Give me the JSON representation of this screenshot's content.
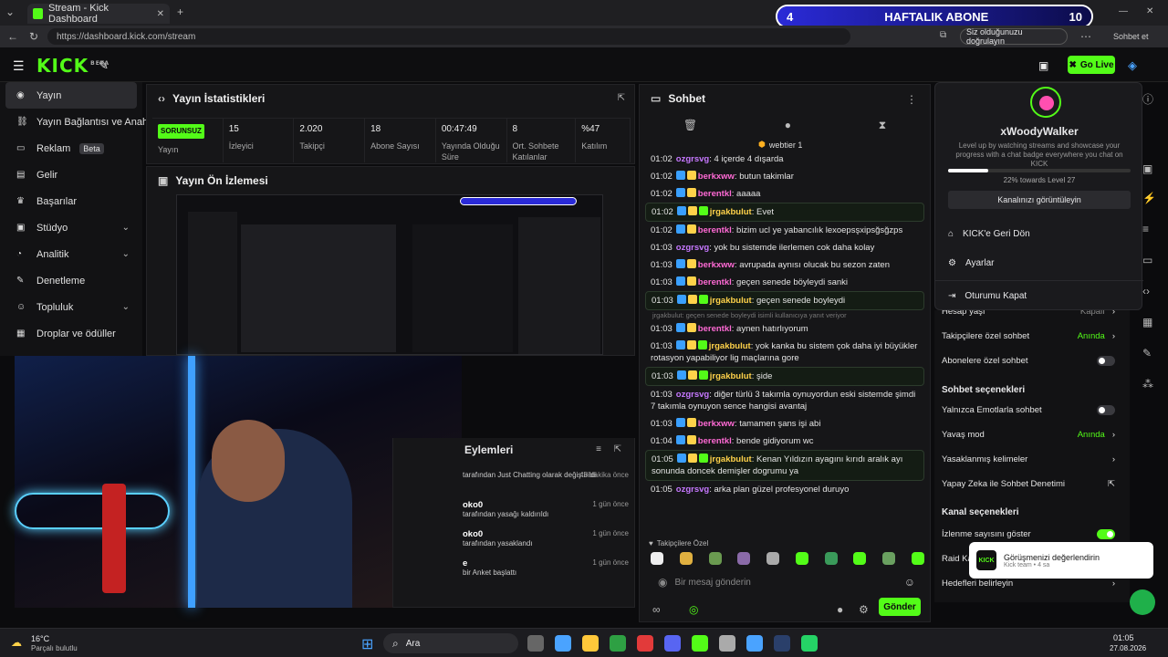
{
  "browser": {
    "tab_title": "Stream - Kick Dashboard",
    "url": "https://dashboard.kick.com/stream",
    "verify_text": "Siz olduğunuzu doğrulayın",
    "sign_in": "Sohbet et"
  },
  "goal_overlay": {
    "left": "4",
    "title": "HAFTALIK ABONE",
    "right": "10"
  },
  "header": {
    "logo": "KICK",
    "beta": "BETA",
    "go_live": "Go Live"
  },
  "sidebar": {
    "items": [
      {
        "label": "Yayın",
        "icon": "menu-icon"
      },
      {
        "label": "Yayın Bağlantısı ve Anahtarı",
        "icon": "link-icon"
      },
      {
        "label": "Reklam",
        "icon": "ad-icon",
        "badge": "Beta"
      },
      {
        "label": "Gelir",
        "icon": "revenue-icon"
      },
      {
        "label": "Başarılar",
        "icon": "trophy-icon"
      },
      {
        "label": "Stüdyo",
        "icon": "studio-icon"
      },
      {
        "label": "Analitik",
        "icon": "analytics-icon"
      },
      {
        "label": "Denetleme",
        "icon": "moderation-icon"
      },
      {
        "label": "Topluluk",
        "icon": "community-icon"
      },
      {
        "label": "Droplar ve ödüller",
        "icon": "drops-icon"
      }
    ]
  },
  "stats": {
    "title": "Yayın İstatistikleri",
    "items": [
      {
        "value": "SORUNSUZ",
        "label": "Yayın"
      },
      {
        "value": "15",
        "label": "İzleyici"
      },
      {
        "value": "2.020",
        "label": "Takipçi"
      },
      {
        "value": "18",
        "label": "Abone Sayısı"
      },
      {
        "value": "00:47:49",
        "label": "Yayında Olduğu Süre"
      },
      {
        "value": "8",
        "label": "Ort. Sohbete Katılanlar"
      },
      {
        "value": "%47",
        "label": "Katılım"
      }
    ]
  },
  "preview": {
    "title": "Yayın Ön İzlemesi"
  },
  "actions": {
    "title": "Eylemleri",
    "rows": [
      {
        "time": "46 dakika önce",
        "text": "tarafından Just Chatting olarak değiştirildi",
        "user": ""
      },
      {
        "time": "1 gün önce",
        "text": "tarafından yasağı kaldırıldı",
        "user": "oko0"
      },
      {
        "time": "1 gün önce",
        "text": "tarafından yasaklandı",
        "user": "oko0"
      },
      {
        "time": "1 gün önce",
        "text": "bir Anket başlattı",
        "user": "e"
      }
    ]
  },
  "chat": {
    "title": "Sohbet",
    "pinned": "webtier 1",
    "messages": [
      {
        "time": "01:02",
        "user": "ozgrsvg",
        "text": "4 içerde 4 dışarda",
        "color": "#c678ff",
        "hl": false
      },
      {
        "time": "01:02",
        "user": "berkxww",
        "text": "butun takimlar",
        "color": "#ff6ad5",
        "hl": false
      },
      {
        "time": "01:02",
        "user": "berentkl",
        "text": "aaaaa",
        "color": "#ff6ad5",
        "hl": false
      },
      {
        "time": "01:02",
        "user": "jrgakbulut",
        "text": "Evet",
        "color": "#ffd24a",
        "hl": true
      },
      {
        "time": "01:02",
        "user": "berentkl",
        "text": "bizim ucl ye yabancılık lexoepsşxipsğsğzps",
        "color": "#ff6ad5",
        "hl": false
      },
      {
        "time": "01:03",
        "user": "ozgrsvg",
        "text": "yok bu sistemde ilerlemen cok daha kolay",
        "color": "#c678ff",
        "hl": false
      },
      {
        "time": "01:03",
        "user": "berkxww",
        "text": "avrupada aynısı olucak bu sezon zaten",
        "color": "#ff6ad5",
        "hl": false
      },
      {
        "time": "01:03",
        "user": "berentkl",
        "text": "geçen senede böyleydi sanki",
        "color": "#ff6ad5",
        "hl": false
      },
      {
        "time": "01:03",
        "user": "jrgakbulut",
        "text": "geçen senede boyleydi",
        "color": "#ffd24a",
        "hl": true
      },
      {
        "time": "01:03",
        "user": "berentkl",
        "text": "aynen hatırlıyorum",
        "color": "#ff6ad5",
        "hl": false
      },
      {
        "time": "01:03",
        "user": "jrgakbulut",
        "text": "yok kanka bu sistem çok daha iyi büyükler rotasyon yapabiliyor lig maçlarına gore",
        "color": "#ffd24a",
        "hl": false
      },
      {
        "time": "01:03",
        "user": "jrgakbulut",
        "text": "şide",
        "color": "#ffd24a",
        "hl": true
      },
      {
        "time": "01:03",
        "user": "ozgrsvg",
        "text": "diğer türlü 3 takımla oynuyordun eski sistemde şimdi 7 takımla oynuyon sence hangisi avantaj",
        "color": "#c678ff",
        "hl": false
      },
      {
        "time": "01:03",
        "user": "berkxww",
        "text": "tamamen şans işi abi",
        "color": "#ff6ad5",
        "hl": false
      },
      {
        "time": "01:04",
        "user": "berentkl",
        "text": "bende gidiyorum wc",
        "color": "#ff6ad5",
        "hl": false
      },
      {
        "time": "01:05",
        "user": "jrgakbulut",
        "text": "Kenan Yıldızın ayagını kırıdı aralık ayı sonunda doncek demişler dogrumu ya",
        "color": "#ffd24a",
        "hl": true
      },
      {
        "time": "01:05",
        "user": "ozgrsvg",
        "text": "arka plan güzel profesyonel duruyo",
        "color": "#c678ff",
        "hl": false
      }
    ],
    "reply_hint": "jrgakbulut: geçen senede boyleydi isimli kullanıcıya yanıt veriyor",
    "followers_only": "Takipçilere Özel",
    "input_placeholder": "Bir mesaj gönderin",
    "send": "Gönder"
  },
  "profile": {
    "name": "xWoodyWalker",
    "desc": "Level up by watching streams and showcase your progress with a chat badge everywhere you chat on KICK",
    "progress_label": "22% towards Level 27",
    "progress": 0.22,
    "channel_btn": "Kanalınızı görüntüleyin",
    "menu": [
      "KICK'e Geri Dön",
      "Ayarlar",
      "Oturumu Kapat"
    ]
  },
  "settings": {
    "rows": [
      {
        "label": "Hesap yaşı",
        "value": "Kapalı",
        "kind": "chev"
      },
      {
        "label": "Takipçilere özel sohbet",
        "value": "Anında",
        "kind": "chev-green"
      },
      {
        "label": "Abonelere özel sohbet",
        "value": "",
        "kind": "toggle-off"
      }
    ],
    "chat_section": "Sohbet seçenekleri",
    "chat_rows": [
      {
        "label": "Yalnızca Emotlarla sohbet",
        "value": "",
        "kind": "toggle-off"
      },
      {
        "label": "Yavaş mod",
        "value": "Anında",
        "kind": "chev-green"
      },
      {
        "label": "Yasaklanmış kelimeler",
        "value": "",
        "kind": "chev"
      },
      {
        "label": "Yapay Zeka ile Sohbet Denetimi",
        "value": "",
        "kind": "ext"
      }
    ],
    "channel_section": "Kanal seçenekleri",
    "channel_rows": [
      {
        "label": "İzlenme sayısını göster",
        "value": "",
        "kind": "toggle-on"
      },
      {
        "label": "Raid Ka",
        "value": "",
        "kind": "none"
      },
      {
        "label": "Hedefleri belirleyin",
        "value": "",
        "kind": "chev"
      }
    ]
  },
  "toast": {
    "title": "Görüşmenizi değerlendirin",
    "sub": "Kick team • 4 sa"
  },
  "taskbar": {
    "weather_temp": "16°C",
    "weather_desc": "Parçalı bulutlu",
    "search": "Ara",
    "time": "01:05",
    "date": "27.08.2026"
  },
  "colors": {
    "accent": "#53fc18",
    "bg": "#0b0b0d",
    "panel": "#161618"
  }
}
